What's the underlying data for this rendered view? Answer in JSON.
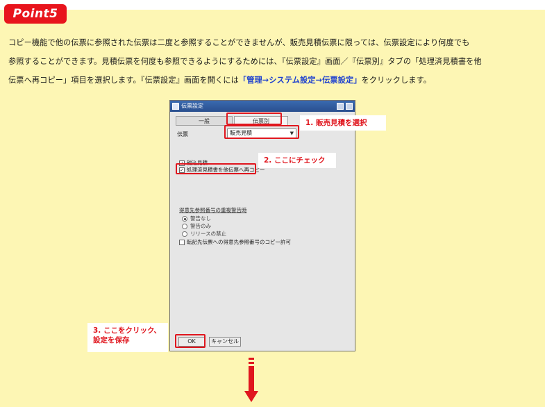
{
  "badge": {
    "label": "Point5"
  },
  "intro": {
    "line1": "コピー機能で他の伝票に参照された伝票は二度と参照することができませんが、販売見積伝票に限っては、伝票設定により何度でも",
    "line2": "参照することができます。見積伝票を何度も参照できるようにするためには、『伝票設定』画面／『伝票別』タブの「処理済見積書を他",
    "line3a": "伝票へ再コピー」項目を選択します。『伝票設定』画面を開くには",
    "line3_link": "「管理→システム設定→伝票設定」",
    "line3b": "をクリックします。"
  },
  "dialog": {
    "title": "伝票設定",
    "tabs": [
      {
        "label": "一般"
      },
      {
        "label": "伝票別"
      }
    ],
    "slip_label": "伝票",
    "slip_value": "販売見積",
    "checkboxes": [
      {
        "label": "税込見積",
        "checked": true
      },
      {
        "label": "処理済見積書を他伝票へ再コピー",
        "checked": true
      }
    ],
    "section_label": "得意先参照番号の重複警告時",
    "radios": [
      {
        "label": "警告なし",
        "selected": true
      },
      {
        "label": "警告のみ",
        "selected": false
      },
      {
        "label": "リリースの禁止",
        "selected": false
      }
    ],
    "bottom_checkbox": {
      "label": "転記先伝票への得意先参照番号のコピー許可",
      "checked": false
    },
    "ok_label": "OK",
    "cancel_label": "キャンセル"
  },
  "callouts": {
    "step1": "1. 販売見積を選択",
    "step2": "2. ここにチェック",
    "step3_line1": "3. ここをクリック、",
    "step3_line2": "設定を保存"
  },
  "colors": {
    "background": "#fdf6b4",
    "accent_red": "#e0161e",
    "link_blue": "#1c3fcf"
  }
}
